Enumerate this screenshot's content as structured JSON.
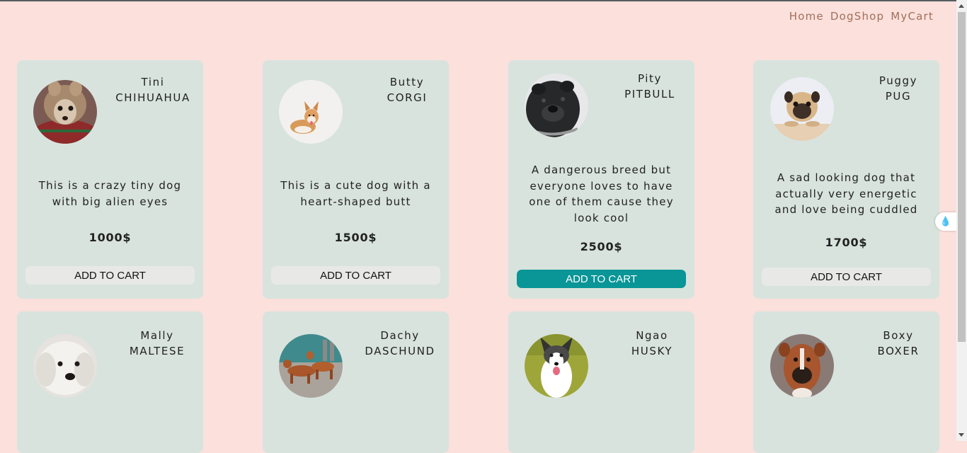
{
  "nav": {
    "links": [
      "Home",
      "DogShop",
      "MyCart"
    ]
  },
  "accent": "#0a9597",
  "cards": [
    {
      "name": "Tini",
      "breed": "CHIHUAHUA",
      "description": "This is a crazy tiny dog with big alien eyes",
      "price": "1000$",
      "button": "ADD TO CART",
      "icon": "chihuahua-photo"
    },
    {
      "name": "Butty",
      "breed": "CORGI",
      "description": "This is a cute dog with a heart-shaped butt",
      "price": "1500$",
      "button": "ADD TO CART",
      "icon": "corgi-photo"
    },
    {
      "name": "Pity",
      "breed": "PITBULL",
      "description": "A dangerous breed but everyone loves to have one of them cause they look cool",
      "price": "2500$",
      "button": "ADD TO CART",
      "icon": "pitbull-photo"
    },
    {
      "name": "Puggy",
      "breed": "PUG",
      "description": "A sad looking dog that actually very energetic and love being cuddled",
      "price": "1700$",
      "button": "ADD TO CART",
      "icon": "pug-photo"
    },
    {
      "name": "Mally",
      "breed": "MALTESE",
      "icon": "maltese-photo"
    },
    {
      "name": "Dachy",
      "breed": "DASCHUND",
      "icon": "dachshund-photo"
    },
    {
      "name": "Ngao",
      "breed": "HUSKY",
      "icon": "husky-photo"
    },
    {
      "name": "Boxy",
      "breed": "BOXER",
      "icon": "boxer-photo"
    }
  ]
}
